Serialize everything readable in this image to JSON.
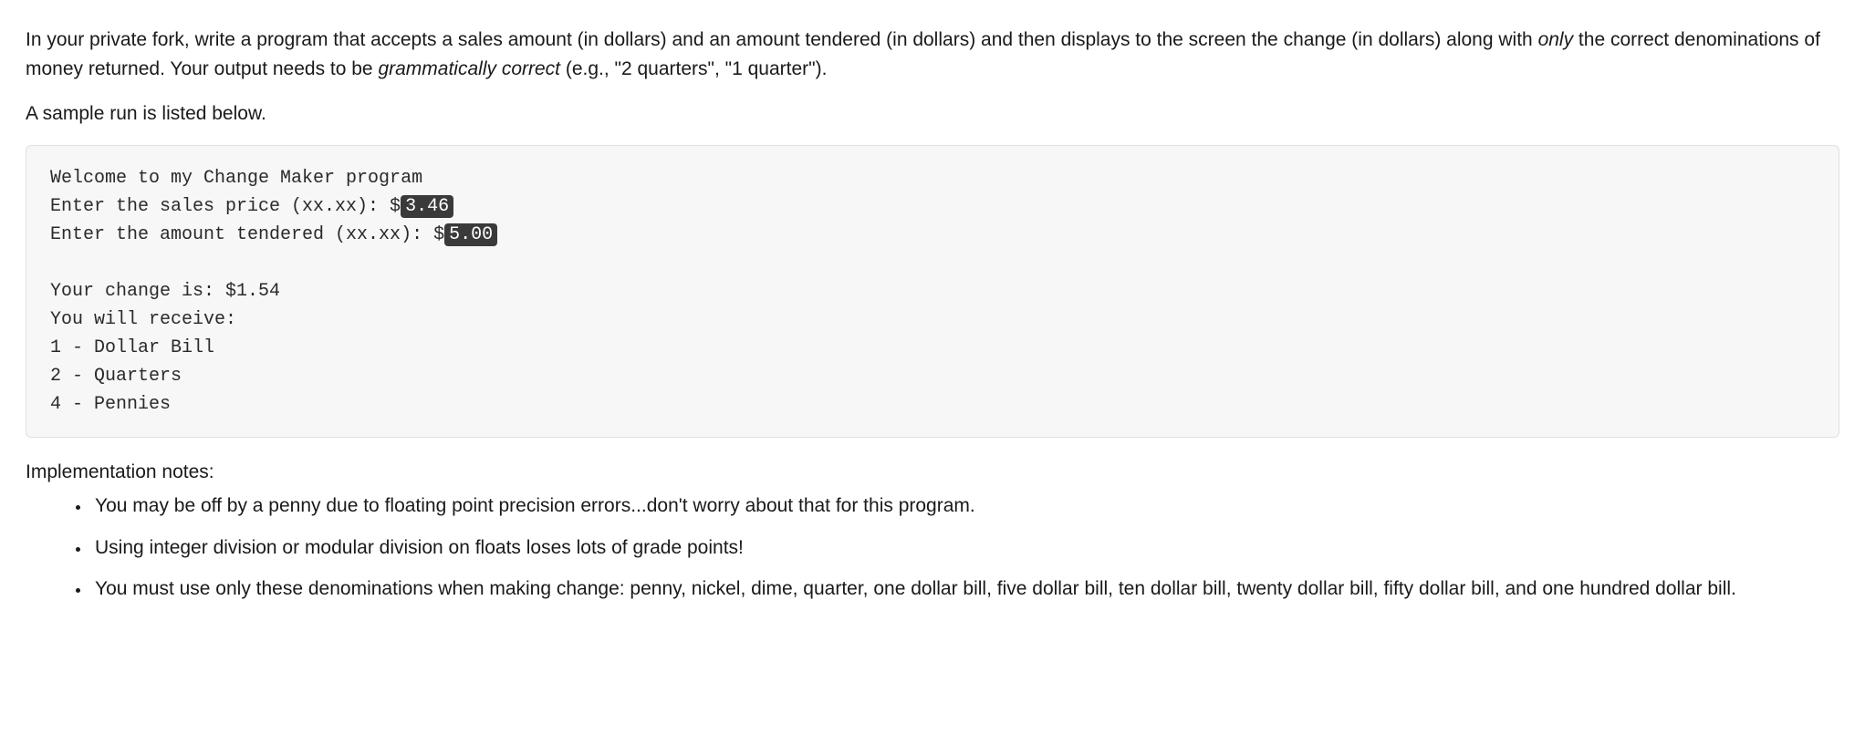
{
  "intro": {
    "part1": "In your private fork, write a program that accepts a sales amount (in dollars) and an amount tendered (in dollars) and then displays to the screen the change (in dollars) along with ",
    "italic1": "only",
    "part2": " the correct denominations of money returned. Your output needs to be ",
    "italic2": "grammatically correct",
    "part3": " (e.g., \"2 quarters\", \"1 quarter\")."
  },
  "sample_intro": "A sample run is listed below.",
  "code": {
    "line1": "Welcome to my Change Maker program",
    "line2a": "Enter the sales price (xx.xx): $",
    "line2_input": "3.46",
    "line3a": "Enter the amount tendered (xx.xx): $",
    "line3_input": "5.00",
    "line4": "",
    "line5": "Your change is: $1.54",
    "line6": "You will receive:",
    "line7": "1 - Dollar Bill",
    "line8": "2 - Quarters",
    "line9": "4 - Pennies"
  },
  "notes": {
    "heading": "Implementation notes:",
    "items": [
      "You may be off by a penny due to floating point precision errors...don't worry about that for this program.",
      "Using integer division or modular division on floats loses lots of grade points!",
      "You must use only these denominations when making change: penny, nickel, dime, quarter, one dollar bill, five dollar bill, ten dollar bill, twenty dollar bill, fifty dollar bill, and one hundred dollar bill."
    ]
  }
}
